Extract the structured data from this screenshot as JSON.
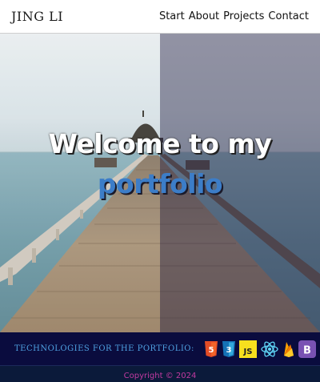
{
  "header": {
    "logo": "JING LI",
    "nav": [
      "Start",
      "About",
      "Projects",
      "Contact"
    ]
  },
  "hero": {
    "title": "Welcome to my",
    "subtitle": "portfolio"
  },
  "technologies": {
    "label": "TECHNOLOGIES FOR THE PORTFOLIO:",
    "icons": [
      "html5-icon",
      "css3-icon",
      "javascript-icon",
      "react-icon",
      "firebase-icon",
      "bootstrap-icon"
    ],
    "js_text": "JS",
    "bootstrap_text": "B",
    "html_text": "5",
    "css_text": "3"
  },
  "footer": {
    "copyright": "Copyright © 2024"
  },
  "colors": {
    "subtitle": "#3c7dc8",
    "techbar_bg": "#0a0c3e",
    "copyright": "#c23aa0"
  }
}
